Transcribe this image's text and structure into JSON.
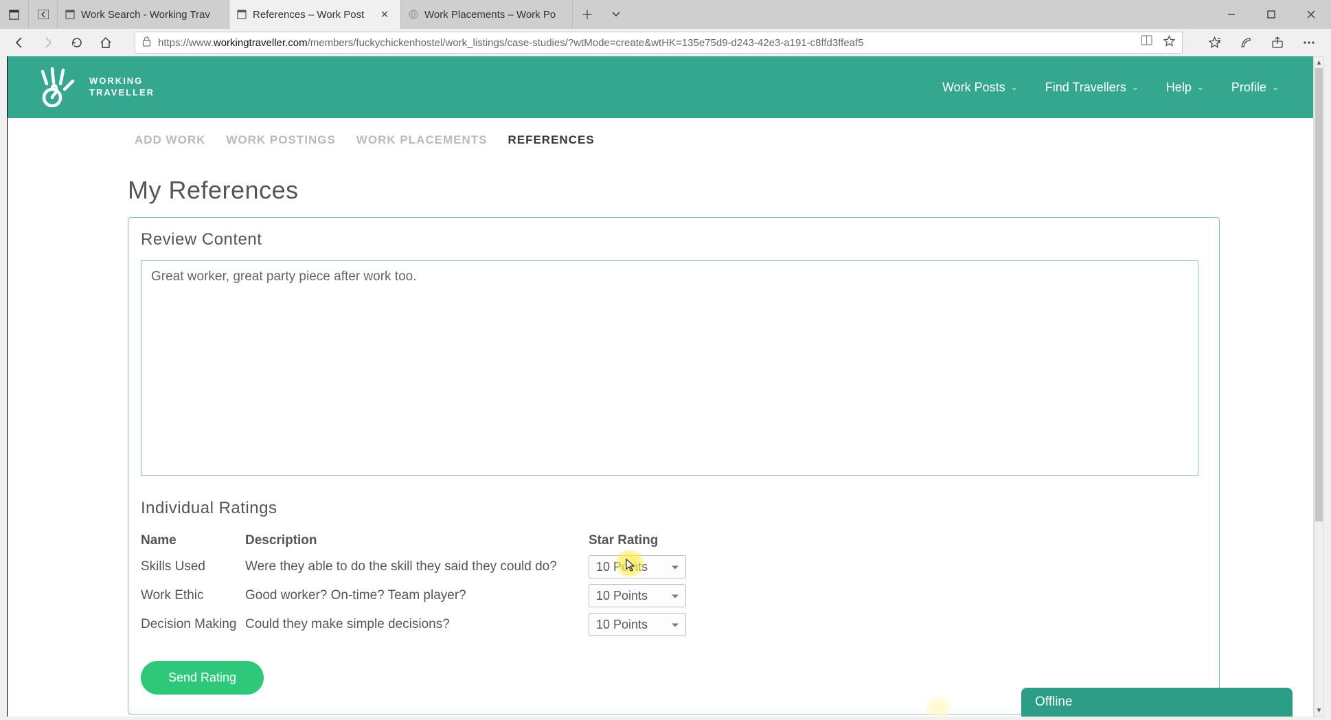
{
  "browser": {
    "tabs": [
      {
        "title": "Work Search - Working Trav",
        "active": false,
        "icon": "page"
      },
      {
        "title": "References – Work Post",
        "active": true,
        "icon": "page"
      },
      {
        "title": "Work Placements – Work Po",
        "active": false,
        "icon": "globe"
      }
    ],
    "url_prefix": "https://www.",
    "url_domain": "workingtraveller.com",
    "url_path": "/members/fuckychickenhostel/work_listings/case-studies/?wtMode=create&wtHK=135e75d9-d243-42e3-a191-c8ffd3ffeaf5"
  },
  "header": {
    "brand_line1": "WORKING",
    "brand_line2": "TRAVELLER",
    "nav": [
      {
        "label": "Work Posts"
      },
      {
        "label": "Find Travellers"
      },
      {
        "label": "Help"
      },
      {
        "label": "Profile"
      }
    ]
  },
  "subtabs": {
    "items": [
      {
        "label": "ADD WORK",
        "active": false
      },
      {
        "label": "WORK POSTINGS",
        "active": false
      },
      {
        "label": "WORK PLACEMENTS",
        "active": false
      },
      {
        "label": "REFERENCES",
        "active": true
      }
    ]
  },
  "page": {
    "title": "My References",
    "review_heading": "Review Content",
    "review_text": "Great worker, great party piece after work too.",
    "ind_heading": "Individual Ratings",
    "table": {
      "headers": {
        "name": "Name",
        "desc": "Description",
        "rating": "Star Rating"
      },
      "rows": [
        {
          "name": "Skills Used",
          "desc": "Were they able to do the skill they said they could do?",
          "rating": "10 Points"
        },
        {
          "name": "Work Ethic",
          "desc": "Good worker? On-time? Team player?",
          "rating": "10 Points"
        },
        {
          "name": "Decision Making",
          "desc": "Could they make simple decisions?",
          "rating": "10 Points"
        }
      ]
    },
    "send_label": "Send Rating"
  },
  "chat": {
    "status": "Offline"
  },
  "colors": {
    "teal_header": "#34a78e",
    "teal_chip": "#2e9d87",
    "green_button": "#2fc87a",
    "highlight": "#ffec50"
  }
}
